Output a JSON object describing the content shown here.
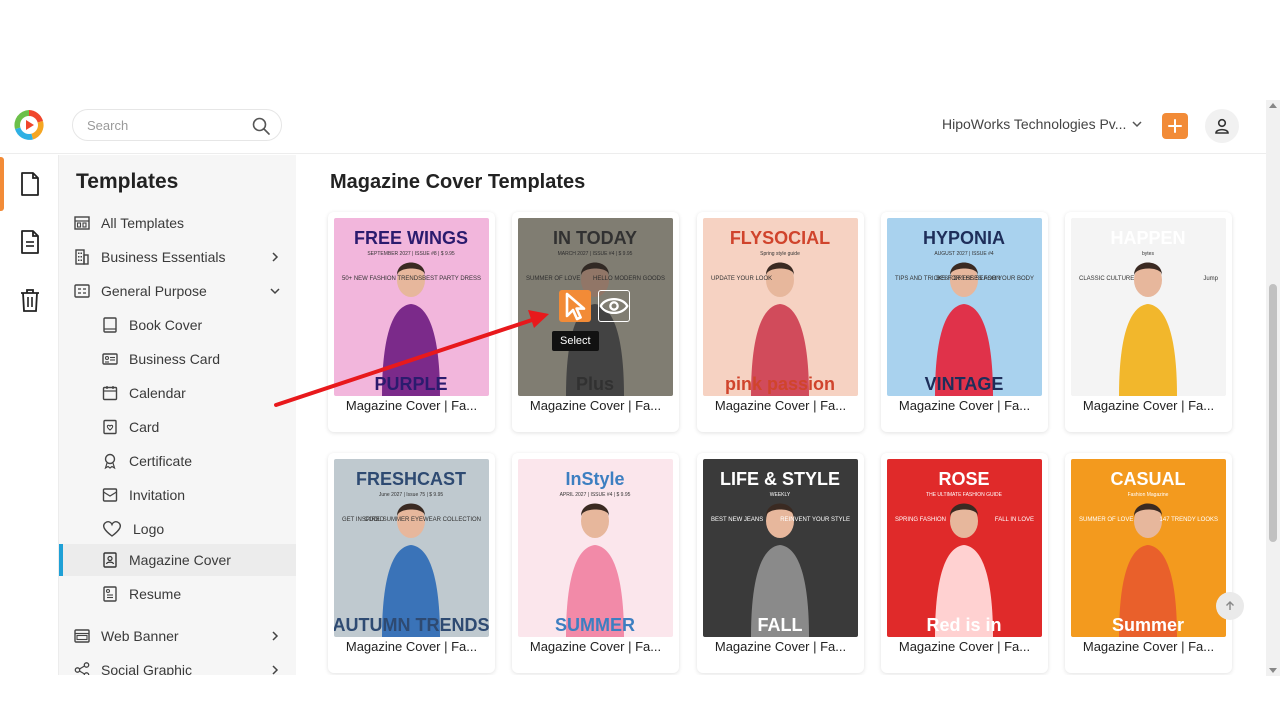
{
  "header": {
    "search_placeholder": "Search",
    "org_name": "HipoWorks Technologies Pv...",
    "brand_color": "#f28b37"
  },
  "sidebar": {
    "title": "Templates",
    "items": [
      {
        "label": "All Templates",
        "icon": "all-templates-icon"
      },
      {
        "label": "Business Essentials",
        "icon": "building-icon"
      },
      {
        "label": "General Purpose",
        "icon": "general-purpose-icon"
      },
      {
        "label": "Book Cover",
        "icon": "book-icon"
      },
      {
        "label": "Business Card",
        "icon": "business-card-icon"
      },
      {
        "label": "Calendar",
        "icon": "calendar-icon"
      },
      {
        "label": "Card",
        "icon": "card-icon"
      },
      {
        "label": "Certificate",
        "icon": "certificate-icon"
      },
      {
        "label": "Invitation",
        "icon": "invitation-icon"
      },
      {
        "label": "Logo",
        "icon": "heart-icon"
      },
      {
        "label": "Magazine Cover",
        "icon": "magazine-icon"
      },
      {
        "label": "Resume",
        "icon": "resume-icon"
      },
      {
        "label": "Web Banner",
        "icon": "web-banner-icon"
      },
      {
        "label": "Social Graphic",
        "icon": "social-graphic-icon"
      }
    ],
    "active_item": "Magazine Cover",
    "active_color": "#1ea0d6"
  },
  "main": {
    "title": "Magazine Cover Templates",
    "hover": {
      "tooltip": "Select"
    },
    "cards": [
      {
        "label": "Magazine Cover | Fa...",
        "cover": {
          "bg": "#f2b6dc",
          "title": "FREE WINGS",
          "title_color": "#2b1b6e",
          "sub": "SEPTEMBER 2027 | ISSUE #8 | $ 9.95",
          "body": "50+ NEW FASHION TRENDS",
          "body2": "BEST PARTY DRESS",
          "foot": "PURPLE",
          "accent": "#7b2a8a"
        }
      },
      {
        "label": "Magazine Cover | Fa...",
        "cover": {
          "bg": "#c9c3b0",
          "title": "IN TODAY",
          "title_color": "#3a3a3a",
          "sub": "MARCH 2027 | ISSUE #4 | $ 9.95",
          "body": "SUMMER OF LOVE",
          "body2": "HELLO MODERN GOODS",
          "foot": "Plus",
          "accent": "#5a5a5a"
        }
      },
      {
        "label": "Magazine Cover | Fa...",
        "cover": {
          "bg": "#f6d2c2",
          "title": "FLYSOCIAL",
          "title_color": "#d0442c",
          "sub": "Spring style guide",
          "body": "UPDATE YOUR LOOK",
          "body2": "",
          "foot": "pink passion",
          "accent": "#d14b5b"
        }
      },
      {
        "label": "Magazine Cover | Fa...",
        "cover": {
          "bg": "#a9d2ee",
          "title": "HYPONIA",
          "title_color": "#1e2e5a",
          "sub": "AUGUST 2027 | ISSUE #4",
          "body": "TIPS AND TRICKS FOR THE SEASON",
          "body2": "BEST DRESSES FOR YOUR BODY",
          "foot": "VINTAGE",
          "accent": "#e0324a"
        }
      },
      {
        "label": "Magazine Cover | Fa...",
        "cover": {
          "bg": "#f4f4f4",
          "title": "HAPPEN",
          "title_color": "#ffffff",
          "sub": "bytes",
          "body": "CLASSIC CULTURE",
          "body2": "Jump",
          "foot": "",
          "accent": "#f2b72c"
        }
      },
      {
        "label": "Magazine Cover | Fa...",
        "cover": {
          "bg": "#bfc9cf",
          "title": "FRESHCAST",
          "title_color": "#2e4a72",
          "sub": "June 2027 | Issue 75 | $ 9.95",
          "body": "GET INSPIRED",
          "body2": "COOL SUMMER EYEWEAR COLLECTION",
          "foot": "AUTUMN TRENDS",
          "accent": "#3a73b8"
        }
      },
      {
        "label": "Magazine Cover | Fa...",
        "cover": {
          "bg": "#fbe6ec",
          "title": "InStyle",
          "title_color": "#3d7fc1",
          "sub": "APRIL 2027 | ISSUE #4 | $ 9.95",
          "body": "",
          "body2": "",
          "foot": "SUMMER",
          "accent": "#f28aa8"
        }
      },
      {
        "label": "Magazine Cover | Fa...",
        "cover": {
          "bg": "#3a3a3a",
          "title": "LIFE & STYLE",
          "title_color": "#ffffff",
          "sub": "WEEKLY",
          "body": "BEST NEW JEANS",
          "body2": "REINVENT YOUR STYLE",
          "foot": "FALL",
          "accent": "#8a8a8a"
        }
      },
      {
        "label": "Magazine Cover | Fa...",
        "cover": {
          "bg": "#e02a2a",
          "title": "ROSE",
          "title_color": "#ffffff",
          "sub": "THE ULTIMATE FASHION GUIDE",
          "body": "SPRING FASHION",
          "body2": "FALL IN LOVE",
          "foot": "Red is in",
          "accent": "#ffd1d1"
        }
      },
      {
        "label": "Magazine Cover | Fa...",
        "cover": {
          "bg": "#f39a1e",
          "title": "CASUAL",
          "title_color": "#ffffff",
          "sub": "Fashion Magazine",
          "body": "SUMMER OF LOVE",
          "body2": "147 TRENDY LOOKS",
          "foot": "Summer",
          "accent": "#e9602b"
        }
      }
    ]
  }
}
